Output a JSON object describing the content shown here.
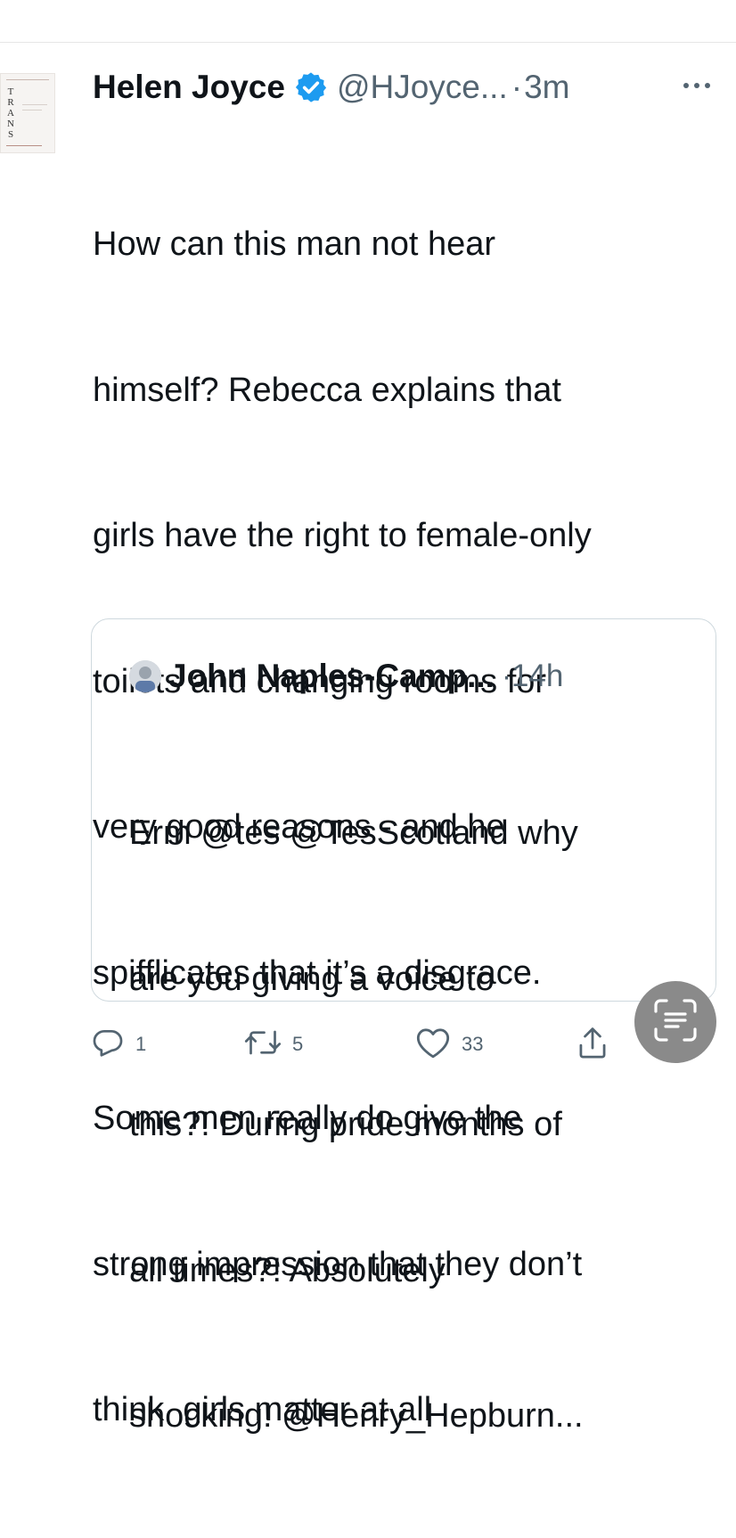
{
  "tweet": {
    "author_name": "Helen Joyce",
    "handle": "@HJoyce...",
    "separator": "·",
    "time": "3m",
    "avatar_spine_text": "T\nR\nA\nN\nS",
    "verified_icon": "verified-badge-icon",
    "more_icon": "more-horizontal-icon",
    "accent_color": "#1d9bf0",
    "body_lines": [
      "How can this man not hear",
      "himself? Rebecca explains that",
      "girls have the right to female-only",
      "toilets and changing rooms for",
      "very good reasons - and he",
      "spifflicates that it’s a disgrace.",
      "Some men really do give the",
      "strong impression that they don’t",
      "think  girls matter at all"
    ]
  },
  "quote": {
    "author_name": "John Naples-Camp...",
    "separator": "·",
    "time": "14h",
    "body_lines": [
      "Erm @tes @TesScotland why",
      "are you giving a voice to",
      "this?! During pride months of",
      "all times?! Absolutely",
      "shocking! @Henry_Hepburn..."
    ]
  },
  "actions": {
    "reply": {
      "icon": "reply-icon",
      "count": "1"
    },
    "retweet": {
      "icon": "retweet-icon",
      "count": "5"
    },
    "like": {
      "icon": "heart-icon",
      "count": "33"
    },
    "share": {
      "icon": "share-icon"
    }
  },
  "overlay": {
    "icon": "text-scan-icon"
  }
}
